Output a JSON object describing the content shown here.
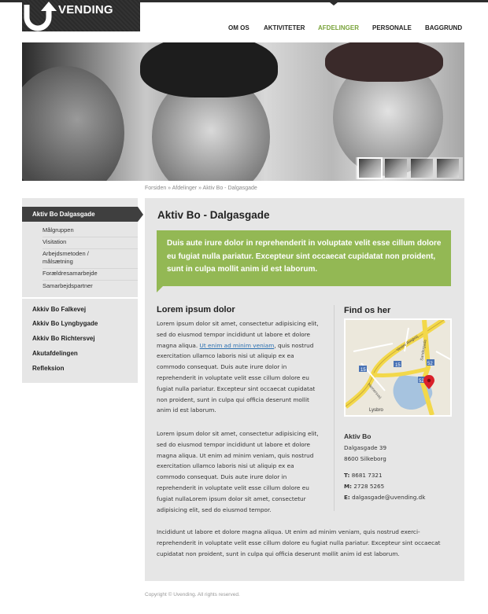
{
  "brand": {
    "name": "VENDING"
  },
  "nav": {
    "items": [
      {
        "label": "OM OS"
      },
      {
        "label": "AKTIVITETER"
      },
      {
        "label": "AFDELINGER"
      },
      {
        "label": "PERSONALE"
      },
      {
        "label": "BAGGRUND"
      }
    ],
    "active": "AFDELINGER"
  },
  "breadcrumb": "Forsiden » Afdelinger » Aktiv Bo - Dalgasgade",
  "sidebar": {
    "active": "Aktiv Bo Dalgasgade",
    "sub_items": [
      "Målgruppen",
      "Visitation",
      "Arbejdsmetoden / målsætning",
      "Forældresamarbejde",
      "Samarbejdspartner"
    ],
    "items": [
      "Akkiv Bo Falkevej",
      "Akkiv Bo Lyngbygade",
      "Akkiv Bo Richtersvej",
      "Akutafdelingen",
      "Refleksion"
    ]
  },
  "main": {
    "title": "Aktiv Bo - Dalgasgade",
    "callout": "Duis aute irure dolor in reprehenderit in voluptate velit esse cillum dolore eu fugiat nulla pariatur.  Excepteur sint occaecat  cupidatat non proident, sunt in culpa mollit anim id est laborum.",
    "left_title": "Lorem ipsum dolor",
    "para1_before": "Lorem ipsum dolor sit amet, consectetur adipisicing elit, sed do eiusmod tempor incididunt ut labore et dolore magna aliqua. ",
    "para1_link": "Ut enim ad minim veniam",
    "para1_after": ", quis nostrud exercitation ullamco laboris nisi ut aliquip ex ea commodo consequat. Duis aute irure dolor in reprehenderit in voluptate velit esse cillum dolore eu fugiat nulla pariatur. Excepteur sint occaecat cupidatat non proident, sunt in culpa qui officia deserunt mollit anim id est laborum.",
    "para2": "Lorem ipsum dolor sit amet, consectetur adipisicing elit, sed do eiusmod tempor incididunt ut labore et dolore magna aliqua. Ut enim ad minim veniam, quis nostrud exercitation ullamco laboris nisi ut aliquip ex ea commodo consequat. Duis aute irure dolor in reprehenderit in voluptate velit esse cillum dolore eu fugiat nullaLorem ipsum dolor sit amet, consectetur adipisicing elit, sed do eiusmod tempor.",
    "para3": "Incididunt ut labore et dolore magna aliqua. Ut enim ad minim veniam, quis nostrud exerci-reprehenderit in voluptate velit esse cillum dolore eu fugiat nulla pariatur. Excepteur sint occaecat cupidatat non proident, sunt in culpa qui officia deserunt mollit anim id est laborum.",
    "right_title": "Find os her",
    "map_labels": {
      "road_a": "Vestre Ringvej",
      "road_b": "Sandergade",
      "road_c": "Hernersvej",
      "num1": "15",
      "num2": "52",
      "num3": "15",
      "num4": "52",
      "place": "Lysbro"
    },
    "address": {
      "name": "Aktiv Bo",
      "street": "Dalgasgade 39",
      "city": "8600 Silkeborg",
      "phone_label": "T:",
      "phone": "8681 7321",
      "mobile_label": "M:",
      "mobile": "2728 5265",
      "email_label": "E:",
      "email": "dalgasgade@uvending.dk"
    }
  },
  "footer": "Copyright © Uvending. All rights reserved.",
  "colors": {
    "accent": "#93b854",
    "nav_active": "#79a33a",
    "dark": "#2d2d2d",
    "panel": "#e6e6e6",
    "link": "#2a6fb0"
  }
}
